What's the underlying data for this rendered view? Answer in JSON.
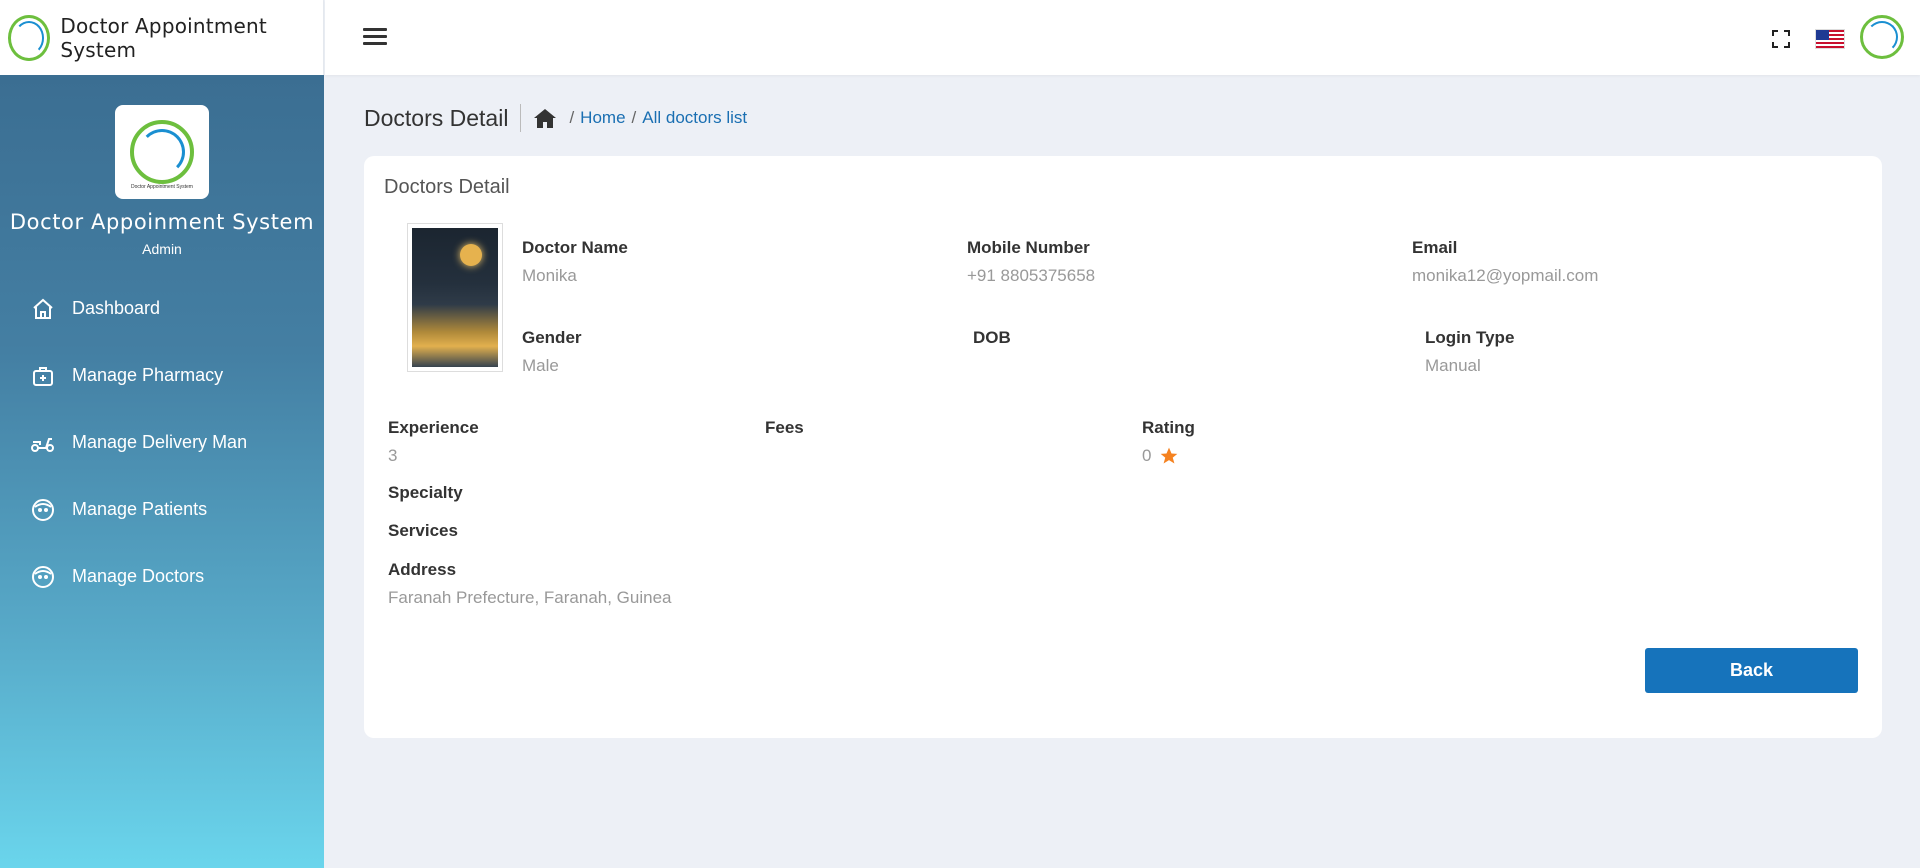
{
  "brand": {
    "name": "Doctor Appointment System"
  },
  "sidebar": {
    "logo_caption": "Doctor Appointment System",
    "title": "Doctor Appoinment System",
    "role": "Admin",
    "items": [
      {
        "label": "Dashboard",
        "icon": "home-icon"
      },
      {
        "label": "Manage Pharmacy",
        "icon": "medical-kit-icon"
      },
      {
        "label": "Manage Delivery Man",
        "icon": "scooter-icon"
      },
      {
        "label": "Manage Patients",
        "icon": "face-icon"
      },
      {
        "label": "Manage Doctors",
        "icon": "face-icon"
      }
    ]
  },
  "header": {
    "page_title": "Doctors Detail"
  },
  "breadcrumb": {
    "home": "Home",
    "current": "All doctors list"
  },
  "card": {
    "title": "Doctors Detail",
    "fields": {
      "doctor_name": {
        "label": "Doctor Name",
        "value": "Monika"
      },
      "mobile": {
        "label": "Mobile Number",
        "value": "+91 8805375658"
      },
      "email": {
        "label": "Email",
        "value": "monika12@yopmail.com"
      },
      "gender": {
        "label": "Gender",
        "value": "Male"
      },
      "dob": {
        "label": "DOB",
        "value": ""
      },
      "login_type": {
        "label": "Login Type",
        "value": "Manual"
      },
      "experience": {
        "label": "Experience",
        "value": "3"
      },
      "fees": {
        "label": "Fees",
        "value": ""
      },
      "rating": {
        "label": "Rating",
        "value": "0"
      },
      "specialty": {
        "label": "Specialty",
        "value": ""
      },
      "services": {
        "label": "Services",
        "value": ""
      },
      "address": {
        "label": "Address",
        "value": "Faranah Prefecture, Faranah, Guinea"
      }
    },
    "back_label": "Back"
  },
  "colors": {
    "primary": "#1673bb",
    "star": "#f58220",
    "link": "#1a6fb2"
  }
}
